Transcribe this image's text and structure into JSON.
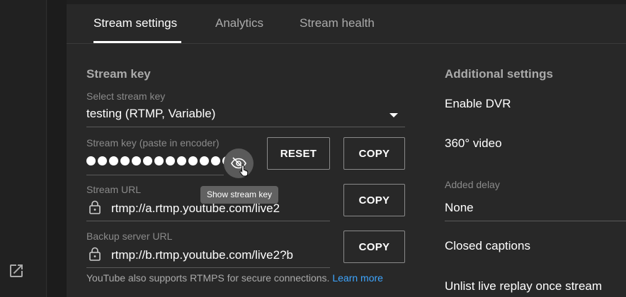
{
  "tabs": [
    {
      "label": "Stream settings",
      "active": true
    },
    {
      "label": "Analytics",
      "active": false
    },
    {
      "label": "Stream health",
      "active": false
    }
  ],
  "stream_key": {
    "title": "Stream key",
    "select_label": "Select stream key",
    "select_value": "testing (RTMP, Variable)",
    "key_label": "Stream key (paste in encoder)",
    "key_masked": "●●●●●●●●●●●●●",
    "show_tooltip": "Show stream key",
    "reset_label": "RESET",
    "copy_label": "COPY"
  },
  "stream_url": {
    "label": "Stream URL",
    "value": "rtmp://a.rtmp.youtube.com/live2",
    "copy_label": "COPY"
  },
  "backup_url": {
    "label": "Backup server URL",
    "value": "rtmp://b.rtmp.youtube.com/live2?b",
    "copy_label": "COPY"
  },
  "footer": {
    "note": "YouTube also supports RTMPS for secure connections.",
    "link": "Learn more"
  },
  "additional": {
    "title": "Additional settings",
    "enable_dvr": "Enable DVR",
    "video_360": "360° video",
    "delay_label": "Added delay",
    "delay_value": "None",
    "closed_captions": "Closed captions",
    "unlist_replay": "Unlist live replay once stream"
  },
  "colors": {
    "background": "#282828",
    "link": "#3ea6ff",
    "muted_text": "#aaaaaa"
  },
  "icons": [
    "external-link-icon",
    "eye-off-icon",
    "lock-icon",
    "dropdown-arrow-icon",
    "hand-cursor-icon"
  ]
}
